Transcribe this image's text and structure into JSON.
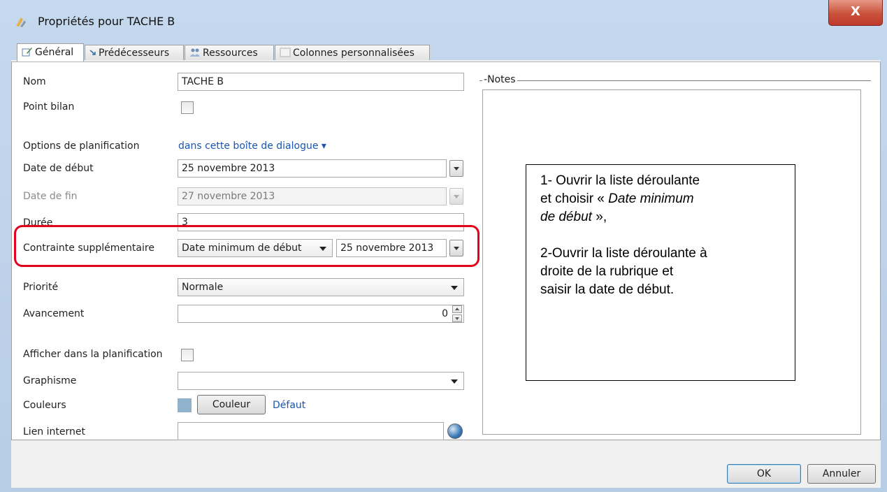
{
  "window": {
    "title": "Propriétés pour TACHE B",
    "close_label": "X"
  },
  "tabs": [
    {
      "label": "Général",
      "icon": "edit-properties-icon",
      "active": true
    },
    {
      "label": "Prédécesseurs",
      "icon": "link-arrow-icon",
      "active": false
    },
    {
      "label": "Ressources",
      "icon": "people-icon",
      "active": false
    },
    {
      "label": "Colonnes personnalisées",
      "icon": "table-icon",
      "active": false
    }
  ],
  "form": {
    "nom": {
      "label": "Nom",
      "value": "TACHE B"
    },
    "point_bilan": {
      "label": "Point bilan",
      "checked": false
    },
    "options": {
      "label": "Options de planification",
      "value": "dans cette boîte de dialogue ▾"
    },
    "date_debut": {
      "label": "Date de début",
      "value": "25 novembre 2013"
    },
    "date_fin": {
      "label": "Date de fin",
      "value": "27 novembre 2013"
    },
    "duree": {
      "label": "Durée",
      "value": "3"
    },
    "contrainte": {
      "label": "Contrainte supplémentaire",
      "type": "Date minimum de début",
      "date": "25 novembre 2013"
    },
    "priorite": {
      "label": "Priorité",
      "value": "Normale"
    },
    "avancement": {
      "label": "Avancement",
      "value": "0"
    },
    "afficher": {
      "label": "Afficher dans la planification",
      "checked": false
    },
    "graphisme": {
      "label": "Graphisme",
      "value": ""
    },
    "couleurs": {
      "label": "Couleurs",
      "button": "Couleur",
      "link": "Défaut",
      "swatch_color": "#8fb3cc"
    },
    "lien": {
      "label": "Lien internet",
      "value": ""
    }
  },
  "notes": {
    "legend": "Notes"
  },
  "callout": {
    "line1": "1- Ouvrir la liste déroulante",
    "line2_prefix": "et choisir  « ",
    "line2_italic": "Date minimum",
    "line3_italic": "de début",
    "line3_suffix": " »,",
    "line4": "2-Ouvrir la liste déroulante à",
    "line5": "droite de la rubrique  et",
    "line6": "saisir la date de début."
  },
  "buttons": {
    "ok": "OK",
    "cancel": "Annuler"
  },
  "colors": {
    "highlight": "#e3001b",
    "link": "#1a56b0",
    "close": "#c9513a"
  }
}
